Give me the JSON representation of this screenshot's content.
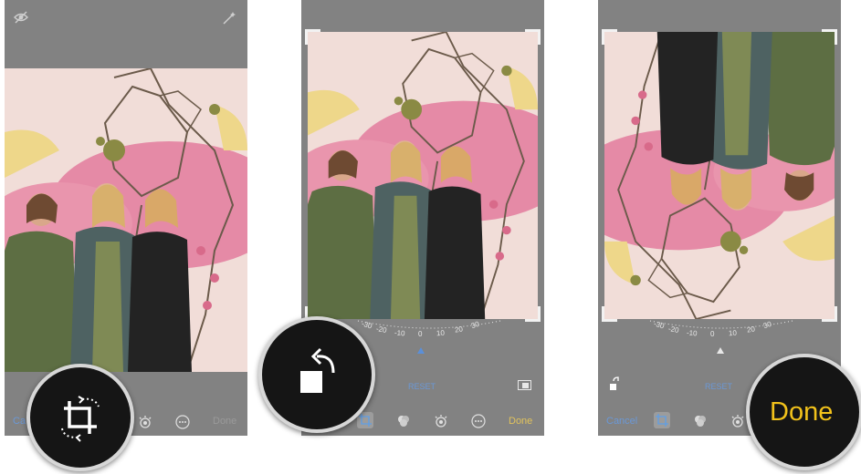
{
  "colors": {
    "accent_blue": "#6b98d6",
    "accent_yellow": "#f2c21b",
    "panel_grey": "#828282",
    "dark_circle": "#151515"
  },
  "panel1": {
    "top_icons": [
      "eye-icon",
      "magic-wand-icon"
    ],
    "cancel_fragment": "Ca",
    "done_label": "Done",
    "toolbar_icons": [
      "crop-rotate-icon",
      "adjust-dial-icon",
      "more-icon"
    ]
  },
  "panel2": {
    "dial_ticks": [
      "-30",
      "-20",
      "-10",
      "0",
      "10",
      "20",
      "30"
    ],
    "reset_label": "RESET",
    "done_label": "Done",
    "toolbar_icons": [
      "crop-icon",
      "filters-icon",
      "adjust-dial-icon",
      "more-icon",
      "aspect-ratio-icon"
    ]
  },
  "panel3": {
    "dial_ticks": [
      "-30",
      "-20",
      "-10",
      "0",
      "10",
      "20",
      "30"
    ],
    "reset_label": "RESET",
    "cancel_label": "Cancel",
    "toolbar_icons": [
      "rotate-icon",
      "crop-icon",
      "filters-icon",
      "adjust-dial-icon"
    ]
  },
  "callouts": {
    "crop_rotate": "crop-rotate-icon",
    "rotate": "rotate-left-icon",
    "done_label": "Done"
  }
}
